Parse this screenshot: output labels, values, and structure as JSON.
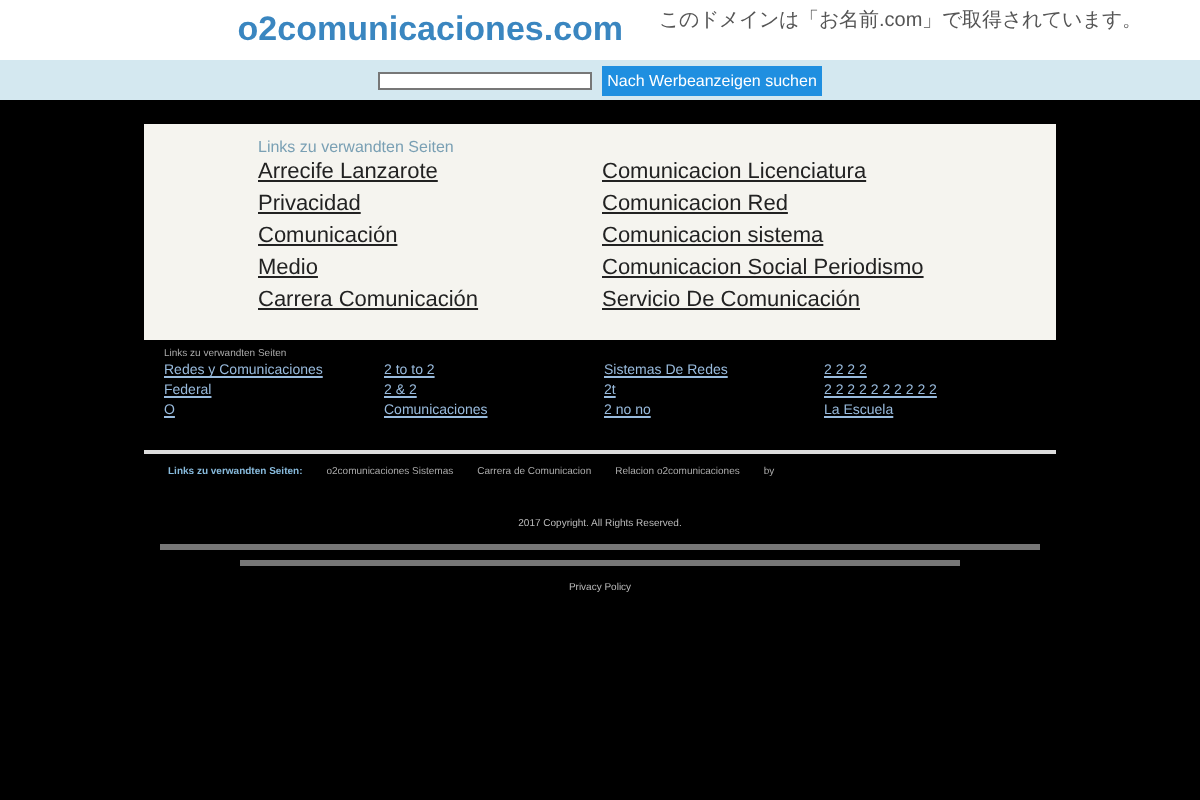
{
  "header": {
    "domain": "o2comunicaciones.com",
    "notice": "このドメインは「お名前.com」で取得されています。"
  },
  "search": {
    "button": "Nach Werbeanzeigen suchen"
  },
  "main_links": {
    "heading": "Links zu verwandten Seiten",
    "items": [
      "Arrecife Lanzarote",
      "Comunicacion Licenciatura",
      "Privacidad",
      "Comunicacion Red",
      "Comunicación",
      "Comunicacion sistema",
      "Medio",
      "Comunicacion Social Periodismo",
      "Carrera Comunicación",
      "Servicio De Comunicación"
    ]
  },
  "related_links": {
    "heading": "Links zu verwandten Seiten",
    "items": [
      "Redes y Comunicaciones",
      "2 to to 2",
      "Sistemas De Redes",
      "2 2 2 2",
      "Federal",
      "2 & 2",
      "2t",
      "2 2 2 2 2 2 2 2 2 2",
      "O",
      "Comunicaciones",
      "2 no no",
      "La Escuela"
    ]
  },
  "bottom_bar": {
    "label": "Links zu verwandten Seiten:",
    "items": [
      "o2comunicaciones Sistemas",
      "Carrera de Comunicacion",
      "Relacion o2comunicaciones",
      "by"
    ]
  },
  "footer": {
    "copyright": "2017 Copyright. All Rights Reserved.",
    "privacy": "Privacy Policy"
  }
}
